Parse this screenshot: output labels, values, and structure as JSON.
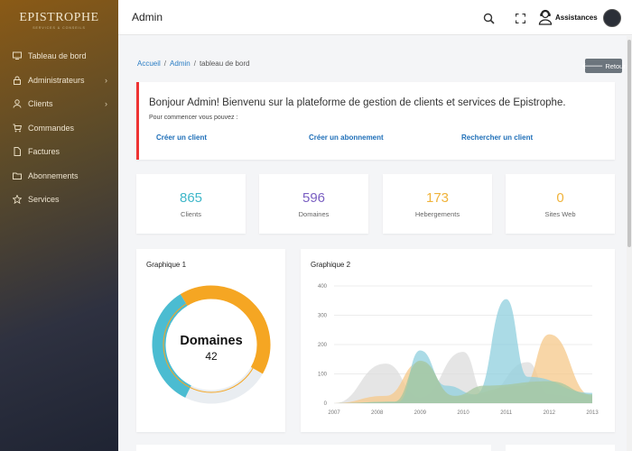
{
  "brand": {
    "title": "EPISTROPHE",
    "subtitle": "SERVICES & CONSEILS"
  },
  "sidebar": {
    "items": [
      {
        "label": "Tableau de bord",
        "icon": "monitor-icon",
        "has_children": false
      },
      {
        "label": "Administrateurs",
        "icon": "lock-icon",
        "has_children": true
      },
      {
        "label": "Clients",
        "icon": "user-icon",
        "has_children": true
      },
      {
        "label": "Commandes",
        "icon": "cart-icon",
        "has_children": false
      },
      {
        "label": "Factures",
        "icon": "file-icon",
        "has_children": false
      },
      {
        "label": "Abonnements",
        "icon": "folder-icon",
        "has_children": false
      },
      {
        "label": "Services",
        "icon": "star-icon",
        "has_children": false
      }
    ]
  },
  "header": {
    "title": "Admin",
    "assist_label": "Assistances"
  },
  "breadcrumb": {
    "home": "Accueil",
    "admin": "Admin",
    "current": "tableau de bord",
    "separator": "/"
  },
  "back_button": {
    "label": "Retour"
  },
  "welcome": {
    "message": "Bonjour Admin! Bienvenu sur la plateforme de gestion de clients et services de Epistrophe.",
    "sub": "Pour commencer vous pouvez :",
    "links": [
      "Créer un client",
      "Créer un abonnement",
      "Rechercher un client"
    ]
  },
  "stats": [
    {
      "value": "865",
      "label": "Clients",
      "color": "#3fb7c9"
    },
    {
      "value": "596",
      "label": "Domaines",
      "color": "#7a5fc2"
    },
    {
      "value": "173",
      "label": "Hebergements",
      "color": "#f0b33a"
    },
    {
      "value": "0",
      "label": "Sites Web",
      "color": "#f0b33a"
    }
  ],
  "chart1": {
    "title": "Graphique 1",
    "center_label": "Domaines",
    "center_value": "42"
  },
  "chart2": {
    "title": "Graphique 2"
  },
  "chart_data": [
    {
      "type": "pie",
      "categories": [
        "",
        "",
        ""
      ],
      "values": [
        42,
        24,
        34
      ],
      "colors": [
        "#f5a623",
        "#e9edf1",
        "#4bbcd1"
      ]
    },
    {
      "type": "area",
      "x": [
        "2007",
        "2008",
        "2009",
        "2010",
        "2011",
        "2012",
        "2013"
      ],
      "ylim": [
        0,
        400
      ],
      "yticks": [
        0,
        100,
        200,
        300,
        400
      ],
      "series": [
        {
          "values": [
            0,
            100,
            40,
            160,
            20,
            180,
            10
          ],
          "peaks": [
            [
              2007,
              0
            ],
            [
              2008.2,
              135
            ],
            [
              2009,
              20
            ],
            [
              2010,
              175
            ],
            [
              2010.5,
              30
            ],
            [
              2011.5,
              140
            ],
            [
              2012,
              30
            ],
            [
              2013,
              10
            ]
          ],
          "color": "#dcdcdc"
        },
        {
          "values": [
            0,
            20,
            140,
            20,
            30,
            230,
            20
          ],
          "peaks": [
            [
              2007,
              0
            ],
            [
              2008.2,
              25
            ],
            [
              2009,
              140
            ],
            [
              2009.8,
              25
            ],
            [
              2011.4,
              60
            ],
            [
              2012,
              235
            ],
            [
              2013,
              25
            ]
          ],
          "color": "#f6c88a"
        },
        {
          "values": [
            0,
            10,
            30,
            20,
            350,
            50,
            30
          ],
          "peaks": [
            [
              2007,
              0
            ],
            [
              2008.5,
              5
            ],
            [
              2009,
              180
            ],
            [
              2009.6,
              60
            ],
            [
              2010.3,
              30
            ],
            [
              2011,
              355
            ],
            [
              2011.5,
              90
            ],
            [
              2013,
              35
            ]
          ],
          "color": "#8fcfdd"
        },
        {
          "values": [
            0,
            5,
            140,
            10,
            50,
            80,
            30
          ],
          "peaks": [
            [
              2007,
              0
            ],
            [
              2008.4,
              5
            ],
            [
              2009,
              145
            ],
            [
              2009.8,
              25
            ],
            [
              2010.5,
              60
            ],
            [
              2012,
              75
            ],
            [
              2013,
              30
            ]
          ],
          "color": "#a6c79f"
        }
      ]
    }
  ]
}
